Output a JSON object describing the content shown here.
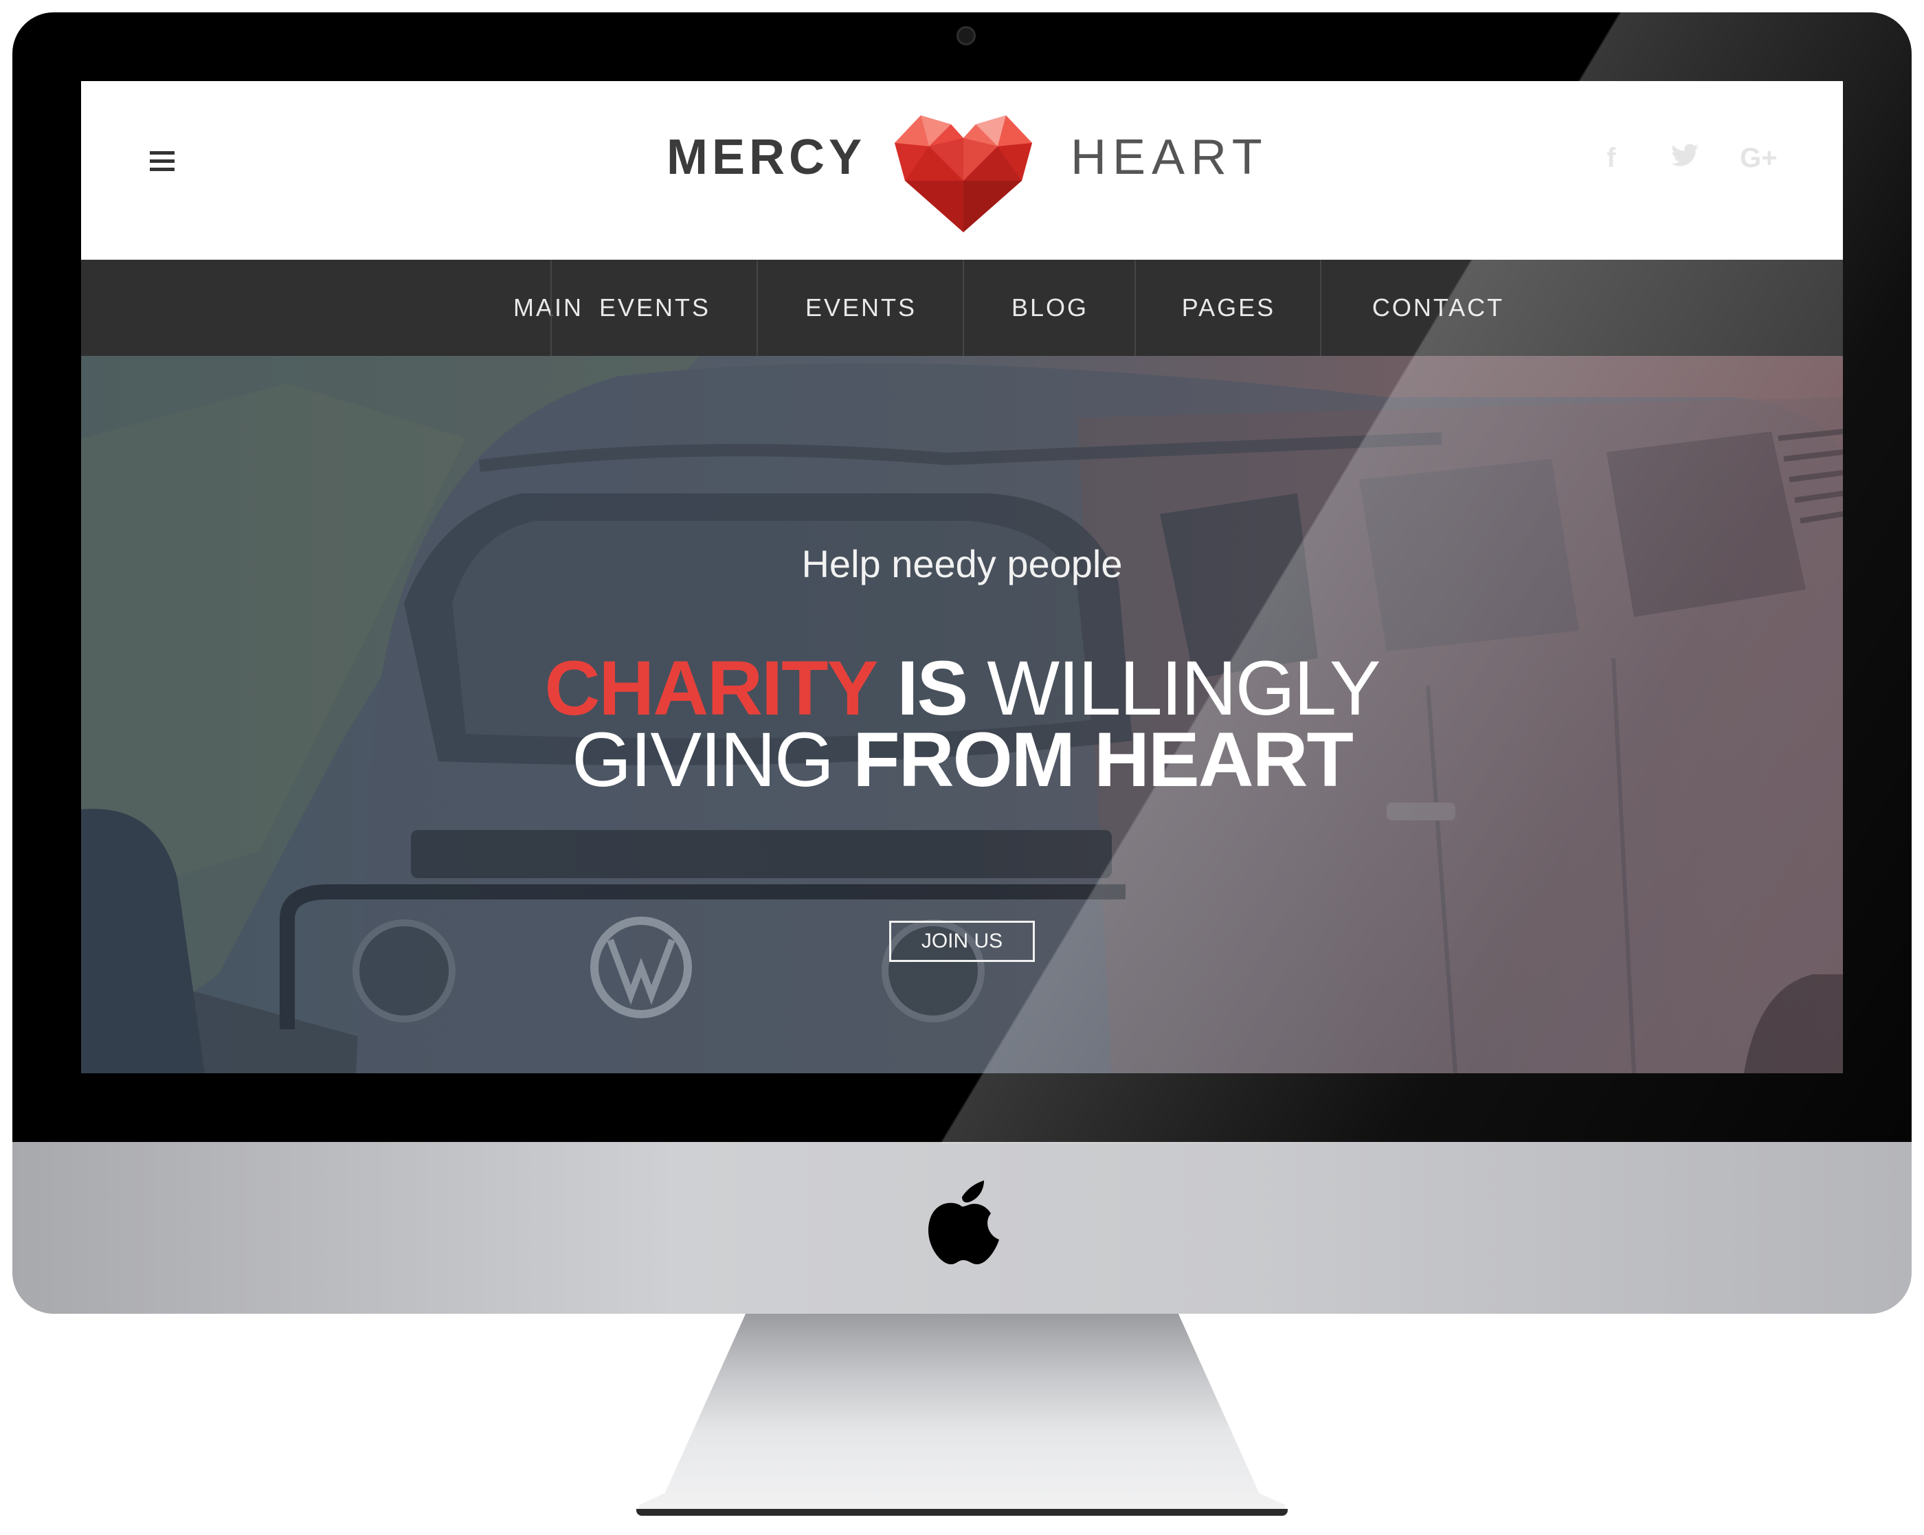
{
  "header": {
    "logo_left": "MERCY",
    "logo_right": "HEART",
    "menu_icon": "hamburger-icon",
    "social": [
      {
        "icon": "facebook-icon",
        "label": "f"
      },
      {
        "icon": "twitter-icon",
        "label": "🐦"
      },
      {
        "icon": "google-plus-icon",
        "label": "G+"
      }
    ]
  },
  "nav": {
    "items": [
      "MAIN",
      "EVENTS",
      "EVENTS",
      "BLOG",
      "PAGES",
      "CONTACT"
    ]
  },
  "hero": {
    "subtitle": "Help needy people",
    "line1": {
      "w1": "CHARITY",
      "w2": "IS",
      "w3": "WILLINGLY"
    },
    "line2": {
      "w1": "GIVING",
      "w2": "FROM HEART"
    },
    "cta_label": "JOIN US"
  },
  "colors": {
    "accent": "#e7403b",
    "nav_bg": "#303030",
    "logo_text": "#3b3b3b",
    "device_bezel": "#000000",
    "device_chin": "#c9cacd"
  }
}
